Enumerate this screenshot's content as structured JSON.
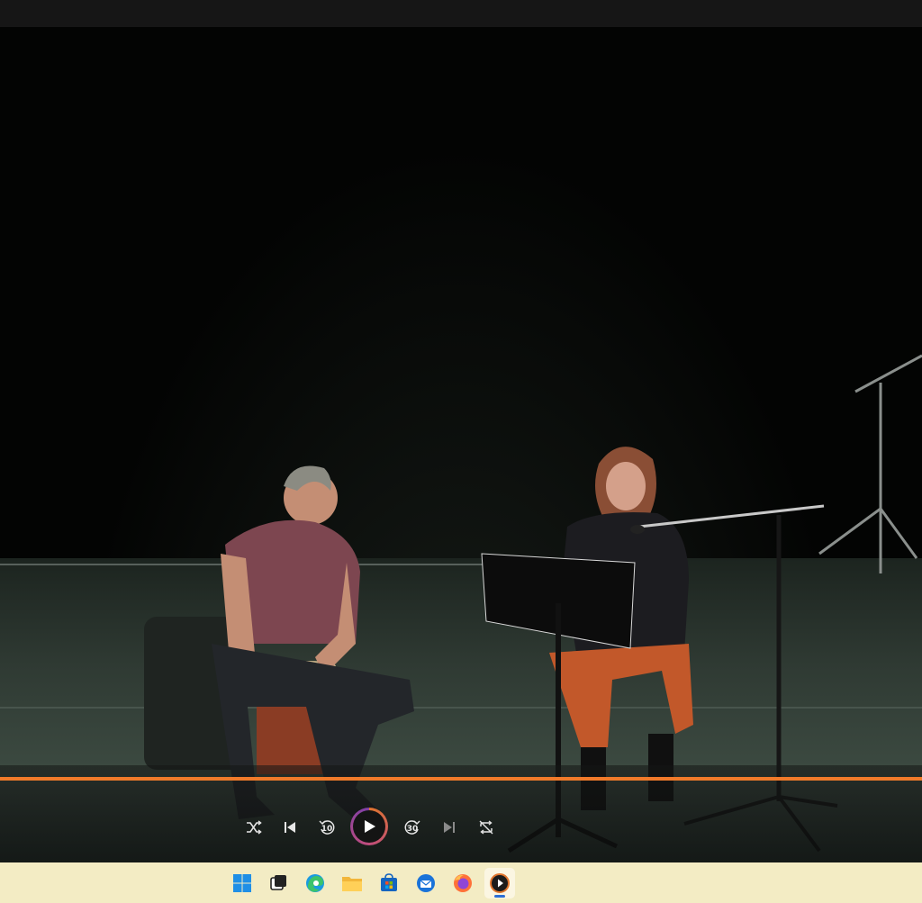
{
  "player": {
    "progress_fraction": 1.0,
    "skip_back_seconds": "10",
    "skip_forward_seconds": "30",
    "accent_color": "#f07a2a"
  },
  "controls": [
    "shuffle-icon",
    "previous-icon",
    "skip-back-10-icon",
    "play-icon",
    "skip-forward-30-icon",
    "next-icon",
    "repeat-icon"
  ],
  "taskbar": {
    "icons": [
      "windows-start-icon",
      "task-view-icon",
      "edge-icon",
      "file-explorer-icon",
      "microsoft-store-icon",
      "thunderbird-icon",
      "firefox-icon",
      "media-player-icon"
    ],
    "active": "media-player-icon"
  }
}
